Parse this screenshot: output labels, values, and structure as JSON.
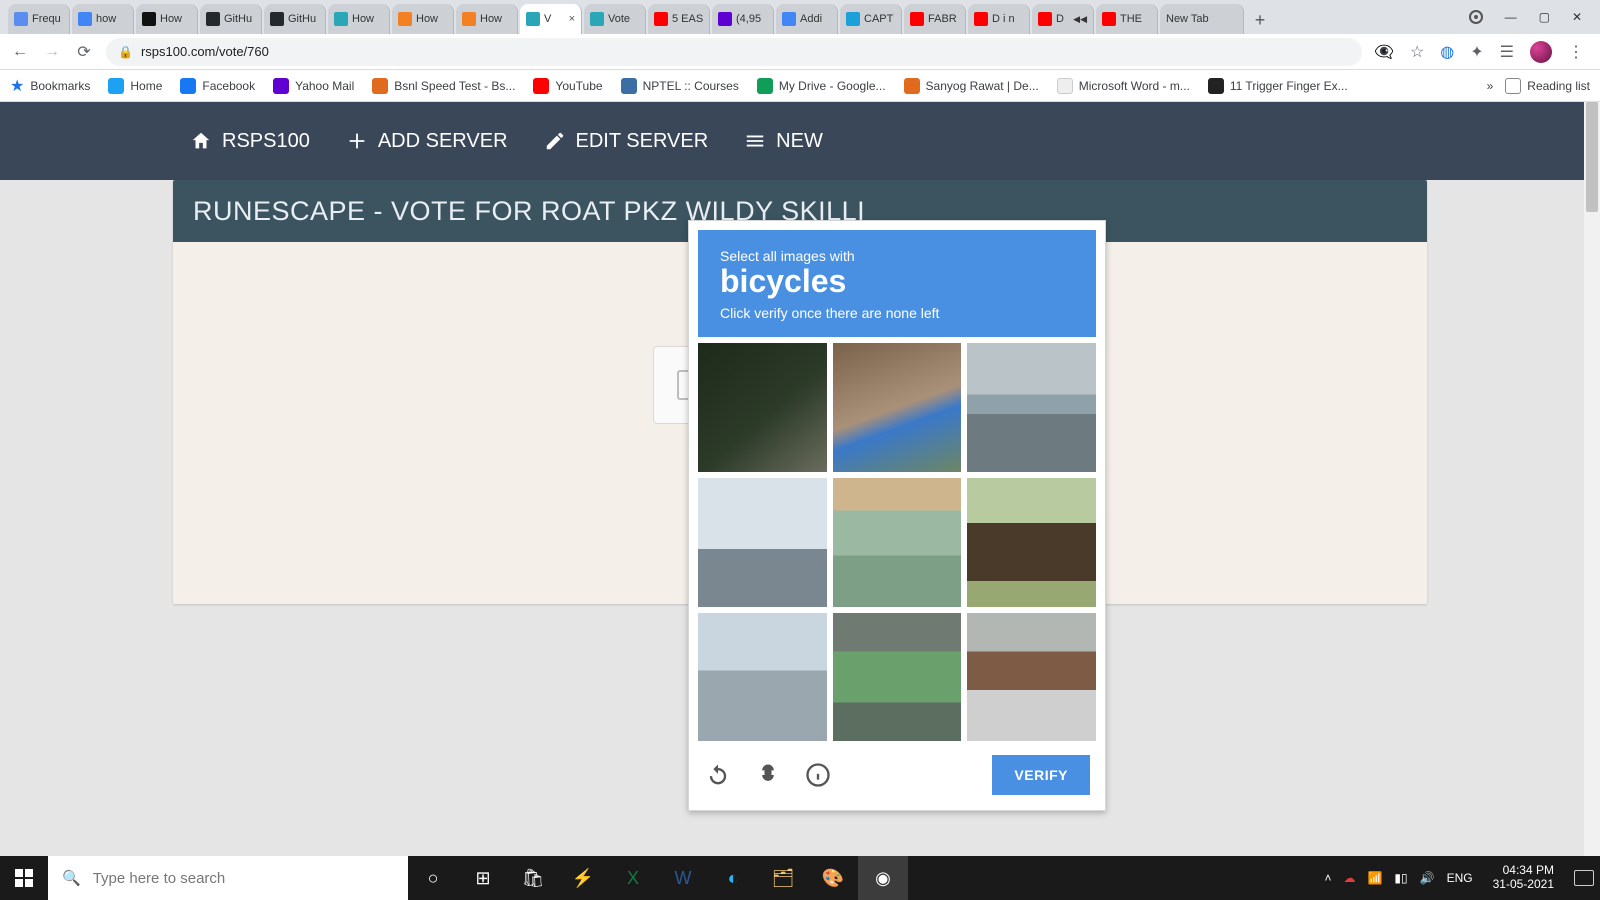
{
  "browser": {
    "tabs": [
      {
        "title": "Frequ",
        "favicon": "f-blue"
      },
      {
        "title": "how",
        "favicon": "f-g"
      },
      {
        "title": "How",
        "favicon": "f-black"
      },
      {
        "title": "GitHu",
        "favicon": "f-gh"
      },
      {
        "title": "GitHu",
        "favicon": "f-gh"
      },
      {
        "title": "How",
        "favicon": "f-teal"
      },
      {
        "title": "How",
        "favicon": "f-so"
      },
      {
        "title": "How",
        "favicon": "f-so"
      },
      {
        "title": "V",
        "favicon": "f-teal",
        "active": true,
        "close": "×"
      },
      {
        "title": "Vote",
        "favicon": "f-teal"
      },
      {
        "title": "5 EAS",
        "favicon": "f-yt"
      },
      {
        "title": "(4,95",
        "favicon": "f-ym"
      },
      {
        "title": "Addi",
        "favicon": "f-g"
      },
      {
        "title": "CAPT",
        "favicon": "f-cap"
      },
      {
        "title": "FABR",
        "favicon": "f-yt"
      },
      {
        "title": "D i n",
        "favicon": "f-yt"
      },
      {
        "title": "D",
        "favicon": "f-yt"
      },
      {
        "title": "THE",
        "favicon": "f-yt"
      },
      {
        "title": "New Tab",
        "favicon": ""
      }
    ],
    "url": "rsps100.com/vote/760",
    "bookmarks": [
      {
        "label": "Bookmarks",
        "icon": "star"
      },
      {
        "label": "Home",
        "icon": "f-twitter"
      },
      {
        "label": "Facebook",
        "icon": "f-fb"
      },
      {
        "label": "Yahoo Mail",
        "icon": "f-ym"
      },
      {
        "label": "Bsnl Speed Test - Bs...",
        "icon": "f-bsnl"
      },
      {
        "label": "YouTube",
        "icon": "f-yt"
      },
      {
        "label": "NPTEL :: Courses",
        "icon": "f-nptel"
      },
      {
        "label": "My Drive - Google...",
        "icon": "f-drive"
      },
      {
        "label": "Sanyog Rawat | De...",
        "icon": "f-bsnl"
      },
      {
        "label": "Microsoft Word - m...",
        "icon": "f-word"
      },
      {
        "label": "11 Trigger Finger Ex...",
        "icon": "f-dark"
      }
    ],
    "reading_list": "Reading list"
  },
  "site_nav": {
    "home": "RSPS100",
    "add": "ADD SERVER",
    "edit": "EDIT SERVER",
    "news": "NEW"
  },
  "panel": {
    "title": "RUNESCAPE - VOTE FOR ROAT PKZ WILDY SKILLI"
  },
  "captcha": {
    "line1": "Select all images with",
    "target": "bicycles",
    "line3": "Click verify once there are none left",
    "verify": "VERIFY"
  },
  "taskbar": {
    "search_placeholder": "Type here to search",
    "lang": "ENG",
    "time": "04:34 PM",
    "date": "31-05-2021"
  }
}
